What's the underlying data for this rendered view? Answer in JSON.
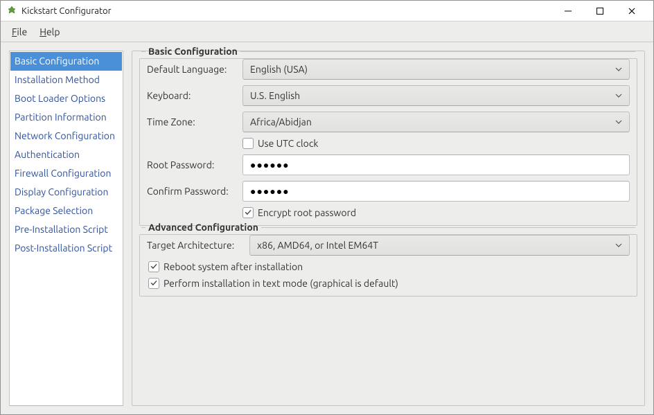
{
  "title": "Kickstart Configurator",
  "menu": {
    "file": "File",
    "help": "Help"
  },
  "sidebar": {
    "items": [
      "Basic Configuration",
      "Installation Method",
      "Boot Loader Options",
      "Partition Information",
      "Network Configuration",
      "Authentication",
      "Firewall Configuration",
      "Display Configuration",
      "Package Selection",
      "Pre-Installation Script",
      "Post-Installation Script"
    ],
    "selected_index": 0
  },
  "basic": {
    "legend": "Basic Configuration",
    "default_language_label": "Default Language:",
    "default_language_value": "English (USA)",
    "keyboard_label": "Keyboard:",
    "keyboard_value": "U.S. English",
    "timezone_label": "Time Zone:",
    "timezone_value": "Africa/Abidjan",
    "utc_label": "Use UTC clock",
    "utc_checked": false,
    "root_pw_label": "Root Password:",
    "root_pw_value": "●●●●●●",
    "confirm_pw_label": "Confirm Password:",
    "confirm_pw_value": "●●●●●●",
    "encrypt_label": "Encrypt root password",
    "encrypt_checked": true
  },
  "advanced": {
    "legend": "Advanced Configuration",
    "target_arch_label": "Target Architecture:",
    "target_arch_value": "x86, AMD64, or Intel EM64T",
    "reboot_label": "Reboot system after installation",
    "reboot_checked": true,
    "textmode_label": "Perform installation in text mode (graphical is default)",
    "textmode_checked": true
  }
}
